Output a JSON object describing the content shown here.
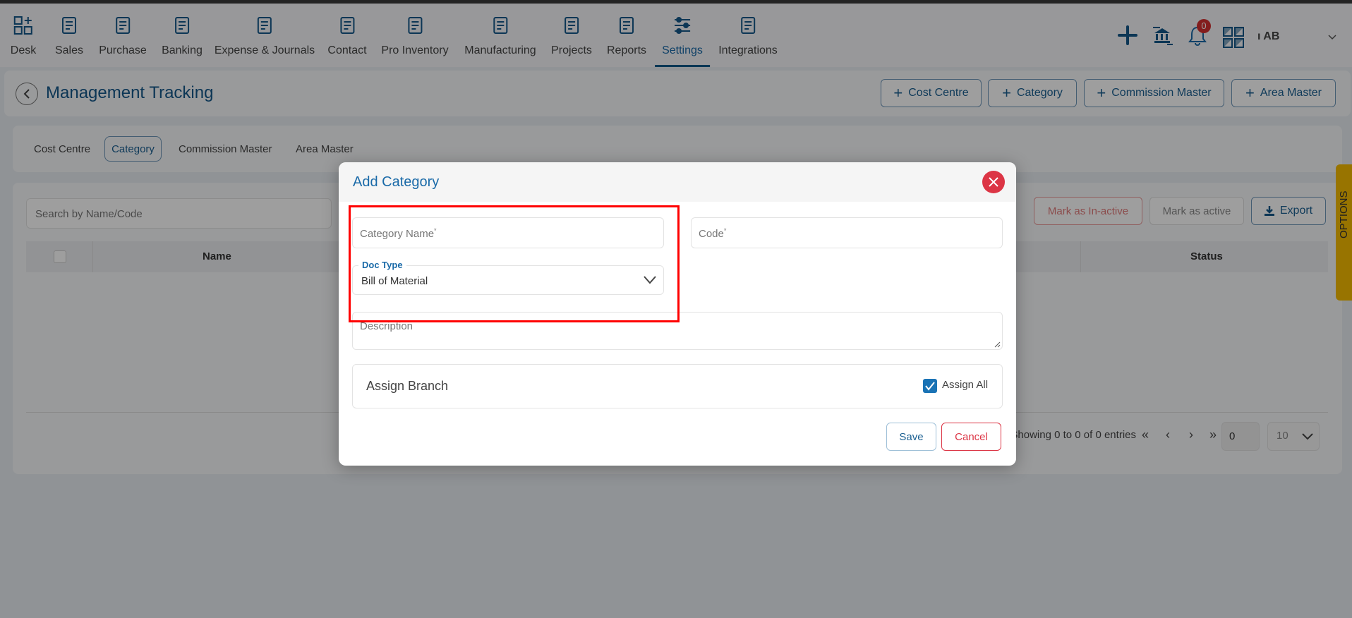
{
  "nav": {
    "items": [
      {
        "label": "Desk",
        "icon": "desk-icon"
      },
      {
        "label": "Sales",
        "icon": "sales-icon"
      },
      {
        "label": "Purchase",
        "icon": "cart-icon"
      },
      {
        "label": "Banking",
        "icon": "bank-icon"
      },
      {
        "label": "Expense & Journals",
        "icon": "journal-icon"
      },
      {
        "label": "Contact",
        "icon": "contacts-icon"
      },
      {
        "label": "Pro Inventory",
        "icon": "inventory-icon"
      },
      {
        "label": "Manufacturing",
        "icon": "manufacturing-icon"
      },
      {
        "label": "Projects",
        "icon": "projects-icon"
      },
      {
        "label": "Reports",
        "icon": "reports-icon"
      },
      {
        "label": "Settings",
        "icon": "settings-sliders-icon",
        "active": true
      },
      {
        "label": "Integrations",
        "icon": "integrations-icon"
      }
    ],
    "notification_count": "0",
    "user": "ı AB"
  },
  "header": {
    "title": "Management Tracking",
    "buttons": [
      "Cost Centre",
      "Category",
      "Commission Master",
      "Area Master"
    ]
  },
  "tabs": [
    {
      "label": "Cost Centre"
    },
    {
      "label": "Category",
      "active": true
    },
    {
      "label": "Commission Master"
    },
    {
      "label": "Area Master"
    }
  ],
  "list": {
    "search_placeholder": "Search by Name/Code",
    "mark_inactive": "Mark as In-active",
    "mark_active": "Mark as active",
    "export": "Export",
    "columns": [
      "Name",
      "Status"
    ],
    "showing": "Showing 0 to 0 of 0 entries",
    "page": "0",
    "page_size": "10"
  },
  "options_tab": "OPTIONS",
  "modal": {
    "title": "Add Category",
    "category_name_placeholder": "Category Name",
    "code_placeholder": "Code",
    "required_mark": "*",
    "doc_type_label": "Doc Type",
    "doc_type_value": "Bill of Material",
    "description_placeholder": "Description",
    "assign_branch": "Assign Branch",
    "assign_all": "Assign All",
    "assign_all_checked": true,
    "save": "Save",
    "cancel": "Cancel"
  },
  "colors": {
    "accent": "#1a6aa8",
    "danger": "#dc3545",
    "highlight": "#ff0000",
    "options": "#f5bc00"
  }
}
